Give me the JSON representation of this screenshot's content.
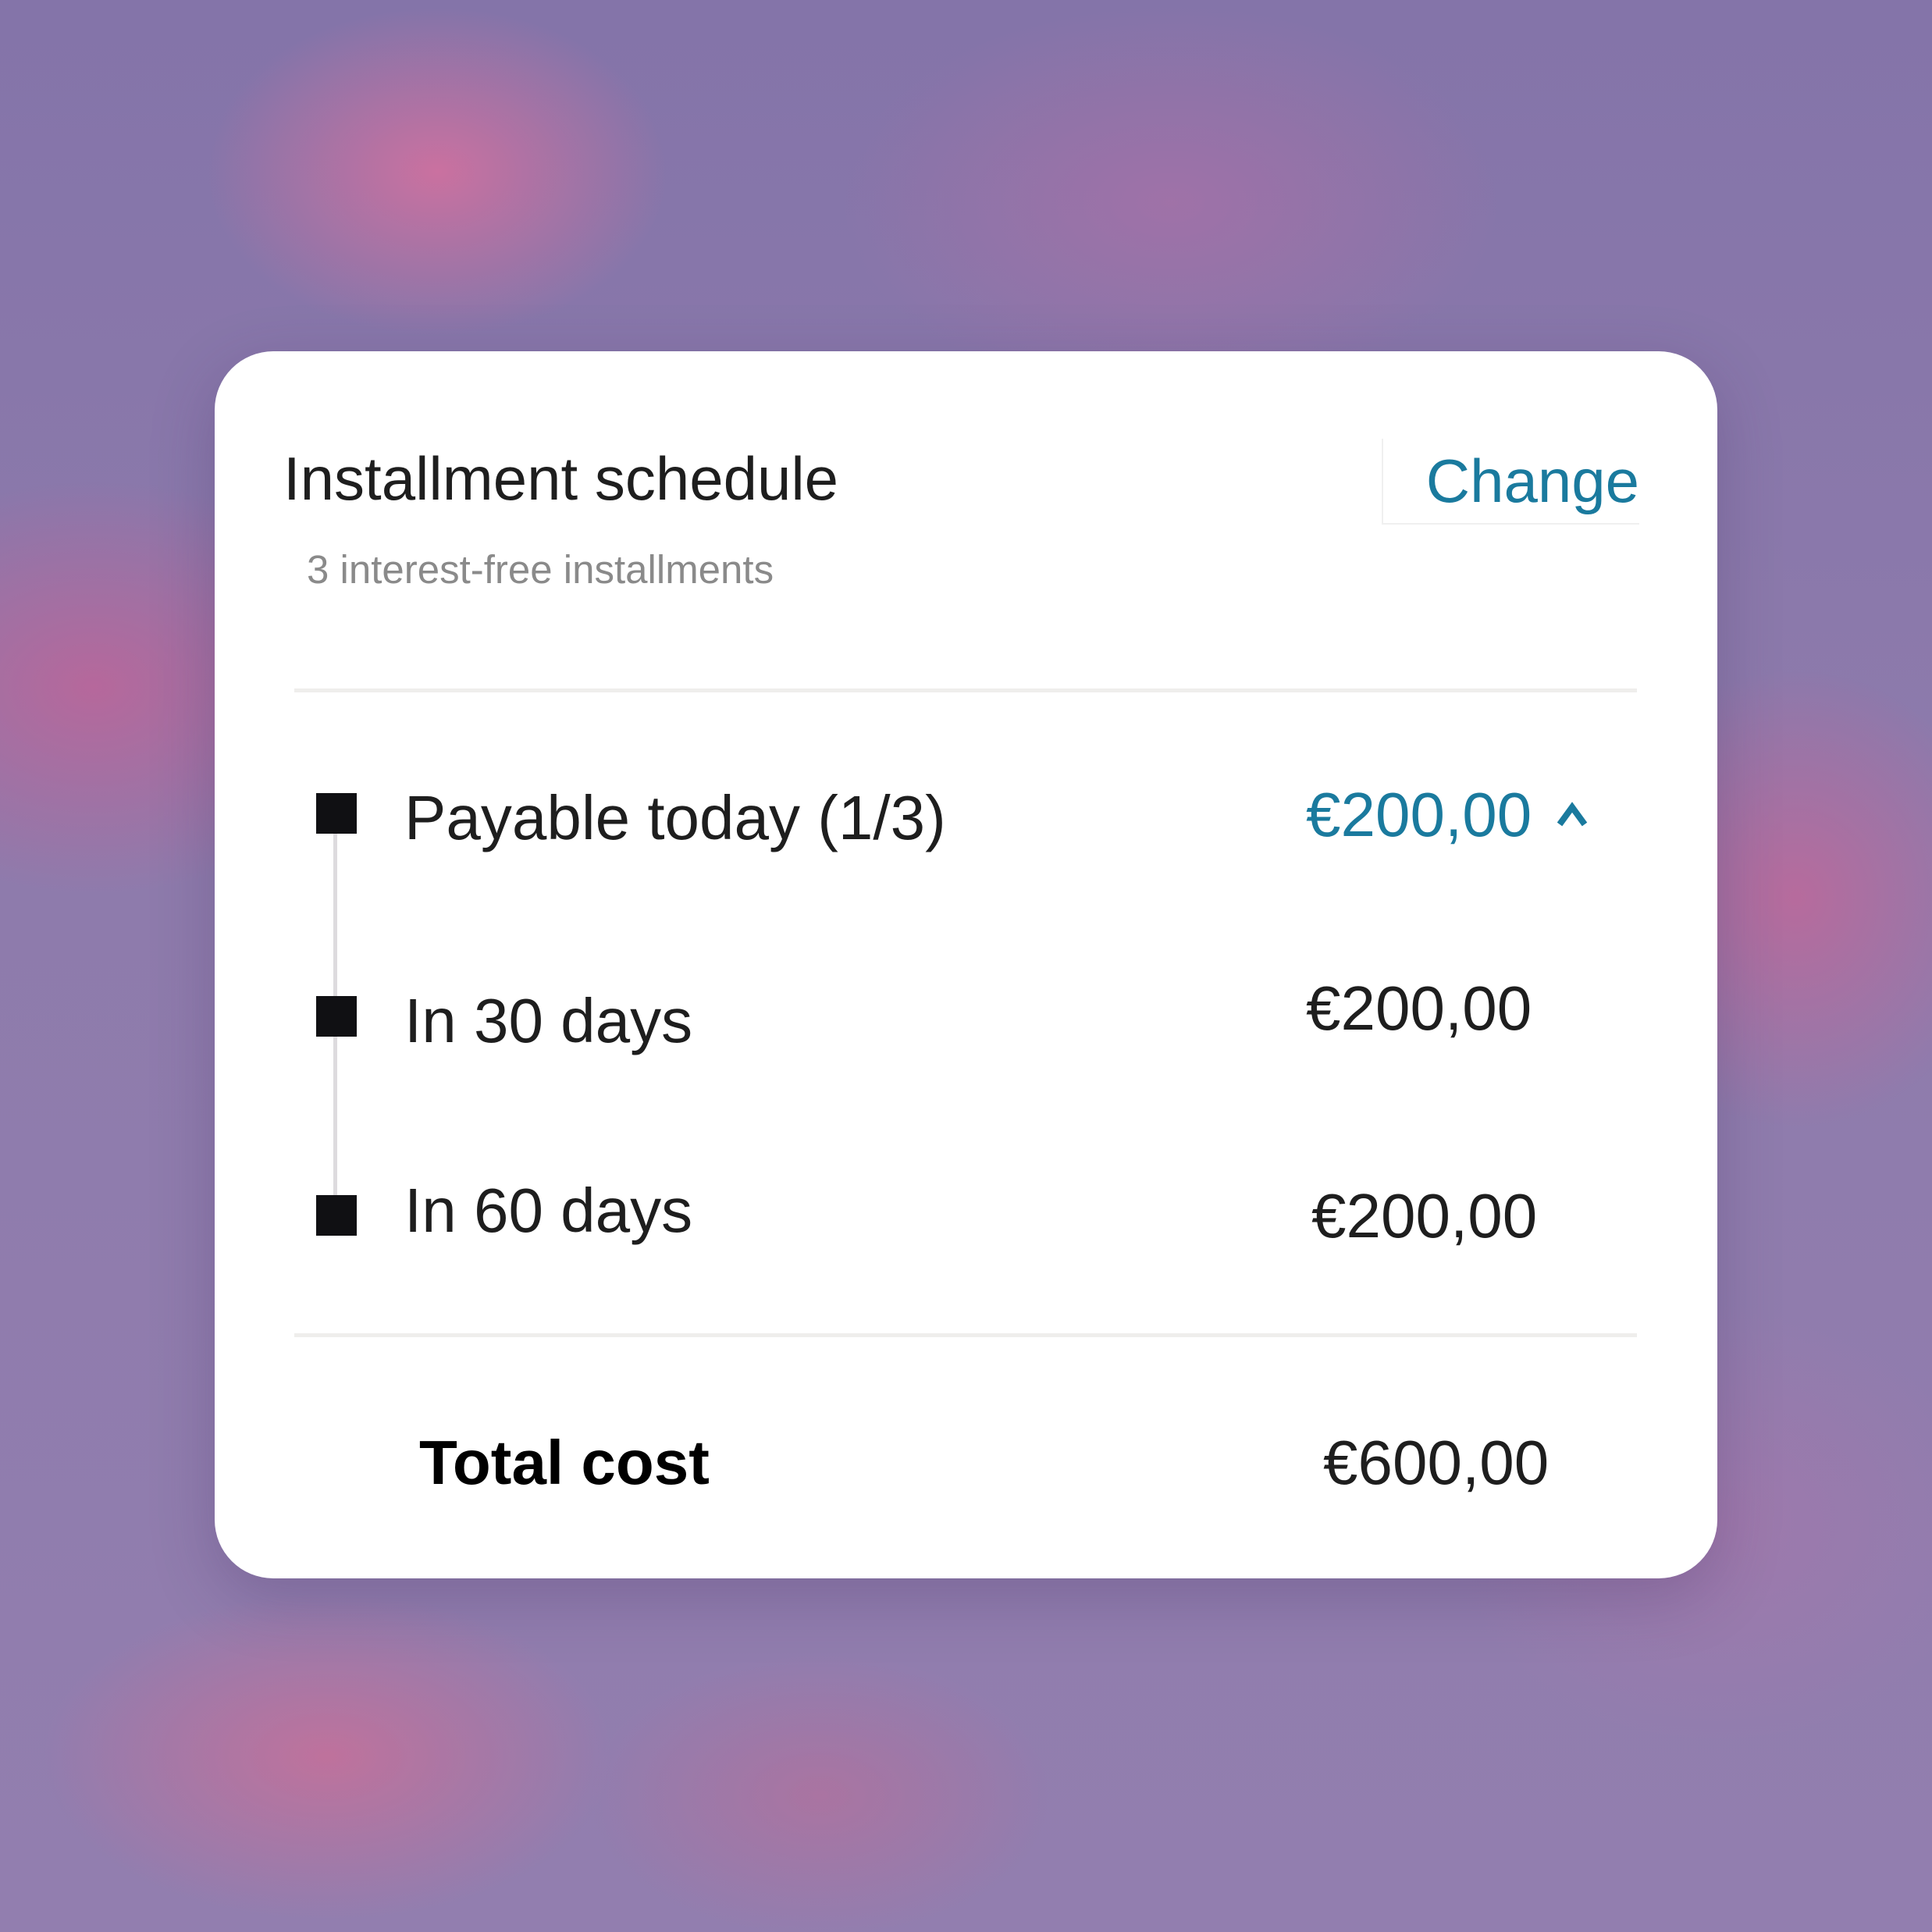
{
  "header": {
    "title": "Installment schedule",
    "subtitle": "3 interest-free installments",
    "change_label": "Change"
  },
  "installments": [
    {
      "label": "Payable today  (1/3)",
      "amount": "€200,00",
      "expanded": true
    },
    {
      "label": "In 30 days",
      "amount": "€200,00"
    },
    {
      "label": "In 60 days",
      "amount": "€200,00"
    }
  ],
  "total": {
    "label": "Total cost",
    "amount": "€600,00"
  },
  "icons": {
    "expand": "chevron-up-icon",
    "marker": "square-marker-icon"
  },
  "colors": {
    "accent": "#1a7a9e",
    "text": "#1e1e1e",
    "muted": "#8a8a8a",
    "marker": "#101013"
  }
}
